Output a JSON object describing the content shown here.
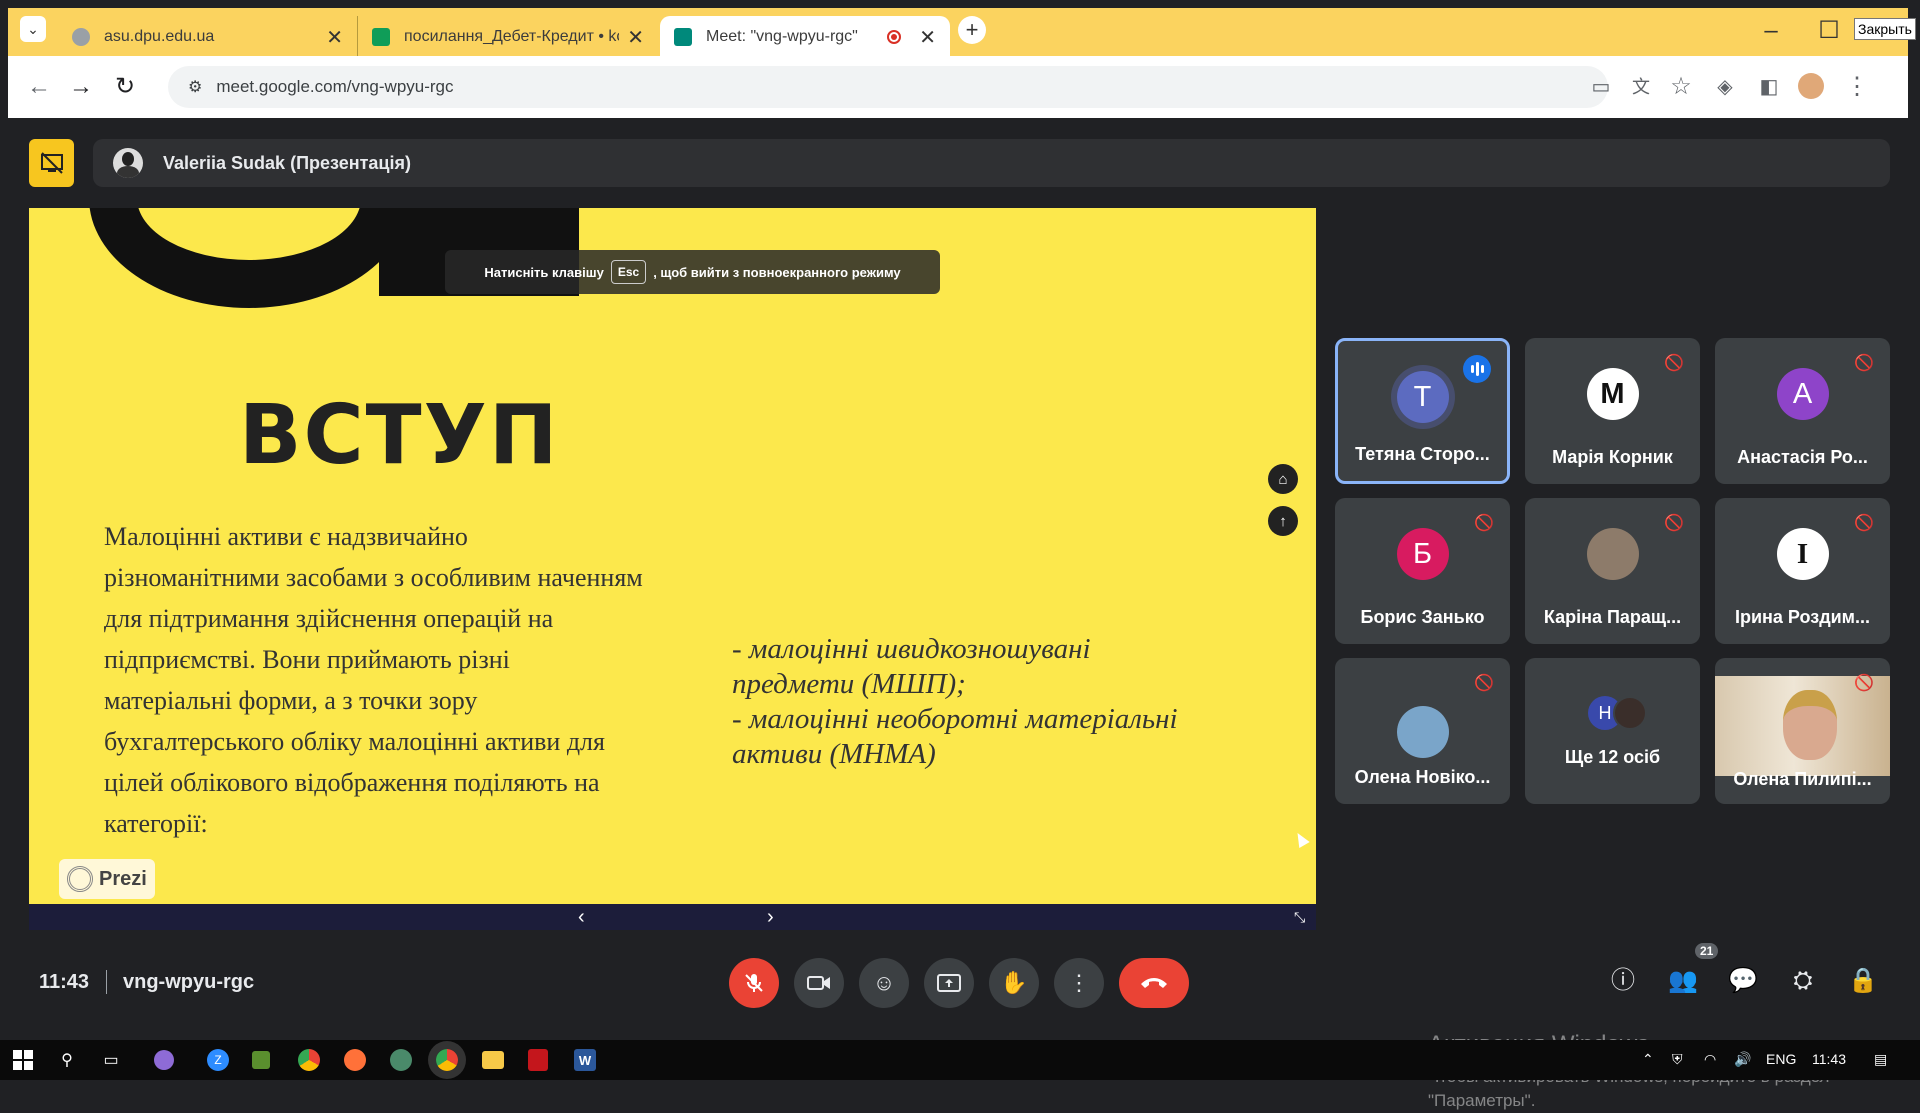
{
  "browser": {
    "tabs": [
      {
        "title": "asu.dpu.edu.ua",
        "favicon_color": "#9aa0a6"
      },
      {
        "title": "посилання_Дебет-Кредит • ko",
        "favicon_color": "#0f9d58"
      },
      {
        "title": "Meet: \"vng-wpyu-rgc\"",
        "favicon_color": "#00897b",
        "active": true
      }
    ],
    "new_tab": "+",
    "url": "meet.google.com/vng-wpyu-rgc",
    "close_tooltip": "Закрыть",
    "accent": "#fbd35f"
  },
  "meet": {
    "presenter_label": "Valeriia Sudak (Презентація)",
    "esc_hint_before": "Натисніть клавішу",
    "esc_key": "Esc",
    "esc_hint_after": ", щоб вийти з повноекранного режиму",
    "time": "11:43",
    "meeting_code": "vng-wpyu-rgc",
    "participants_count": "21"
  },
  "slide": {
    "heading": "ВСТУП",
    "paragraph": "Малоцінні активи є надзвичайно різноманітними засобами з особливим наченням для підтримання здійснення операцій на підприємстві. Вони приймають різні матеріальні форми, а з точки зору бухгалтерського обліку малоцінні активи для цілей облікового відображення поділяють на категорії:",
    "list_line1": "- малоцінні швидкозношувані предмети (МШП);",
    "list_line2": "- малоцінні необоротні матеріальні активи (МНМА)",
    "brand": "Prezi",
    "background": "#fce84c"
  },
  "tiles": [
    {
      "letter": "Т",
      "name": "Тетяна Сторо...",
      "color": "#5c6bc0",
      "speaking": true
    },
    {
      "letter": "М",
      "name": "Марія Корник",
      "color": "#ffffff"
    },
    {
      "letter": "А",
      "name": "Анастасія Ро...",
      "color": "#8e44c9"
    },
    {
      "letter": "Б",
      "name": "Борис Занько",
      "color": "#d81b60"
    },
    {
      "letter": "",
      "name": "Каріна Паращ...",
      "color": "#8d7b6a"
    },
    {
      "letter": "I",
      "name": "Ірина Роздим...",
      "color": "#ffffff"
    },
    {
      "letter": "",
      "name": "Олена Новіко...",
      "color": "#7aa5c9"
    },
    {
      "letter": "Н",
      "name": "Ще 12 осіб",
      "color": "#3949ab"
    },
    {
      "letter": "",
      "name": "Олена Пилипі...",
      "color": "#c8b59a"
    }
  ],
  "watermark": {
    "line1": "Активация Windows",
    "line2": "Чтобы активировать Windows, перейдите в раздел",
    "line3": "\"Параметры\"."
  },
  "taskbar": {
    "lang": "ENG",
    "clock": "11:43"
  }
}
